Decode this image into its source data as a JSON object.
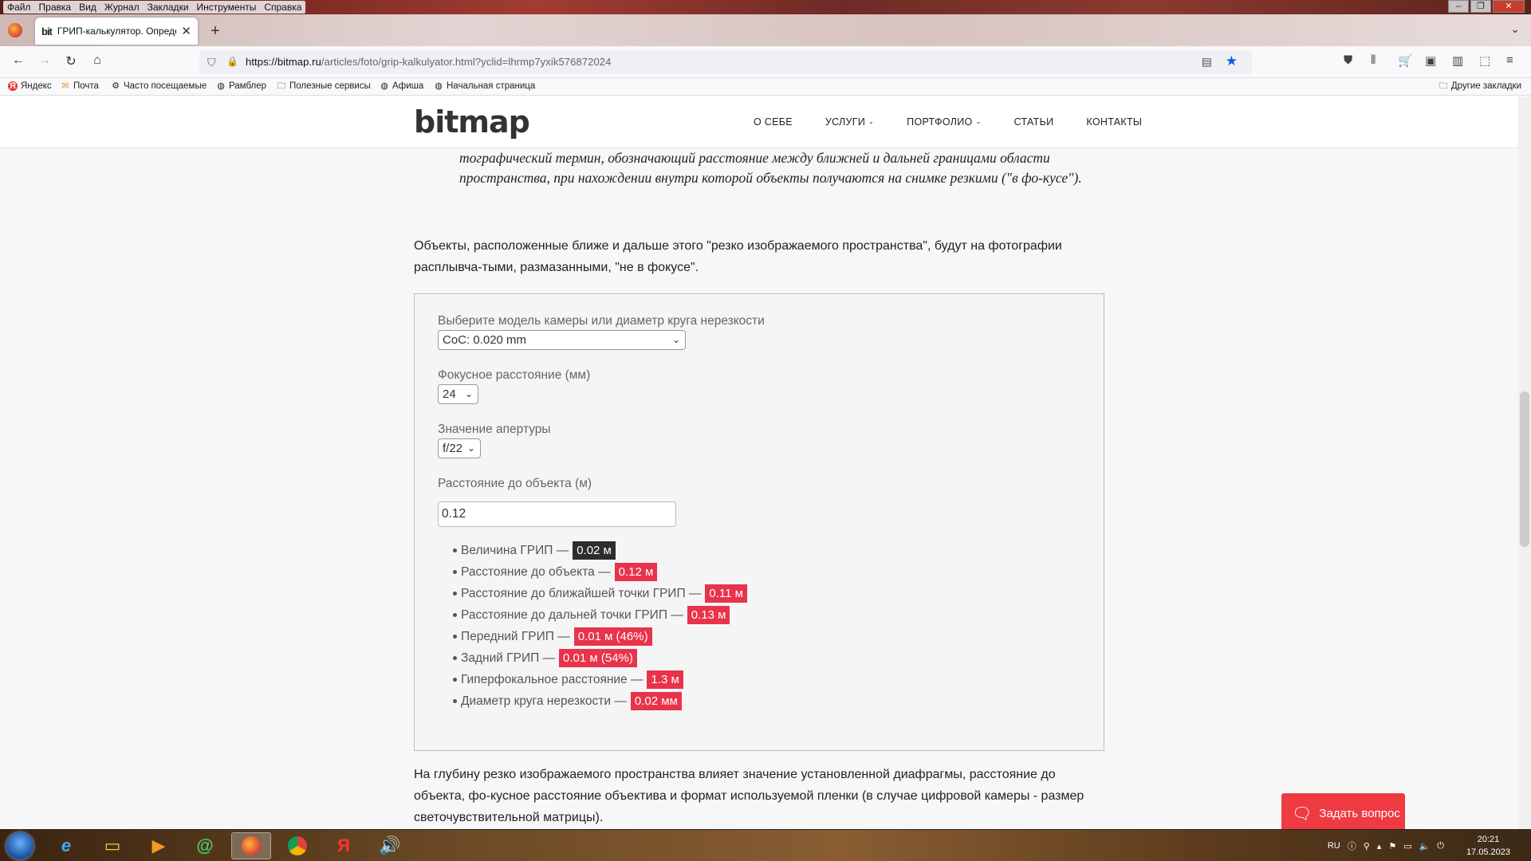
{
  "menu": [
    "Файл",
    "Правка",
    "Вид",
    "Журнал",
    "Закладки",
    "Инструменты",
    "Справка"
  ],
  "tab": {
    "favicon": "bit",
    "title": "ГРИП-калькулятор. Определе"
  },
  "url": {
    "host": "https://bitmap.ru",
    "path": "/articles/foto/grip-kalkulyator.html?yclid=lhrmp7yxik576872024"
  },
  "bookmarks": [
    {
      "label": "Яндекс",
      "icon": "yandex-icon"
    },
    {
      "label": "Почта",
      "icon": "mail-icon"
    },
    {
      "label": "Часто посещаемые",
      "icon": "gear-icon"
    },
    {
      "label": "Рамблер",
      "icon": "globe-icon"
    },
    {
      "label": "Полезные сервисы",
      "icon": "folder-icon"
    },
    {
      "label": "Афиша",
      "icon": "globe-icon"
    },
    {
      "label": "Начальная страница",
      "icon": "globe-icon"
    }
  ],
  "bookmarks_other": "Другие закладки",
  "site": {
    "logo": "bitmap",
    "nav": [
      {
        "label": "О СЕБЕ",
        "dropdown": false
      },
      {
        "label": "УСЛУГИ",
        "dropdown": true
      },
      {
        "label": "ПОРТФОЛИО",
        "dropdown": true
      },
      {
        "label": "СТАТЬИ",
        "dropdown": false
      },
      {
        "label": "КОНТАКТЫ",
        "dropdown": false
      }
    ]
  },
  "article": {
    "quote": "тографический термин, обозначающий расстояние между ближней и дальней границами области пространства, при нахождении внутри которой объекты получаются на снимке резкими (\"в фо-кусе\").",
    "para1": "Объекты, расположенные ближе и дальше этого \"резко изображаемого пространства\", будут на фотографии расплывча-тыми, размазанными, \"не в фокусе\".",
    "para2": "На глубину резко изображаемого пространства влияет значение установленной диафрагмы, расстояние до объекта, фо-кусное расстояние объектива и формат используемой пленки (в случае цифровой камеры - размер светочувствительной матрицы)."
  },
  "calculator": {
    "camera_label": "Выберите модель камеры или диаметр круга нерезкости",
    "camera_value": "CoC: 0.020 mm",
    "focal_label": "Фокусное расстояние (мм)",
    "focal_value": "24",
    "aperture_label": "Значение апертуры",
    "aperture_value": "f/22",
    "distance_label": "Расстояние до объекта (м)",
    "distance_value": "0.12",
    "results": [
      {
        "label": "Величина ГРИП —",
        "value": "0.02 м",
        "dark": true
      },
      {
        "label": "Расстояние до объекта —",
        "value": "0.12 м",
        "dark": false
      },
      {
        "label": "Расстояние до ближайшей точки ГРИП —",
        "value": "0.11 м",
        "dark": false
      },
      {
        "label": "Расстояние до дальней точки ГРИП —",
        "value": "0.13 м",
        "dark": false
      },
      {
        "label": "Передний ГРИП —",
        "value": "0.01 м (46%)",
        "dark": false
      },
      {
        "label": "Задний ГРИП —",
        "value": "0.01 м (54%)",
        "dark": false
      },
      {
        "label": "Гиперфокальное расстояние —",
        "value": "1.3 м",
        "dark": false
      },
      {
        "label": "Диаметр круга нерезкости —",
        "value": "0.02 мм",
        "dark": false
      }
    ]
  },
  "ask_button": "Задать вопрос",
  "taskbar": {
    "apps": [
      "ie-icon",
      "explorer-icon",
      "media-player-icon",
      "mail-agent-icon",
      "firefox-icon",
      "chrome-icon",
      "yandex-browser-icon",
      "sound-icon"
    ],
    "lang": "RU",
    "time": "20:21",
    "date": "17.05.2023"
  },
  "colors": {
    "accent": "#e8334a",
    "dark_badge": "#2d2d2d",
    "ask_button": "#ef3a42",
    "link_star": "#0060df"
  }
}
